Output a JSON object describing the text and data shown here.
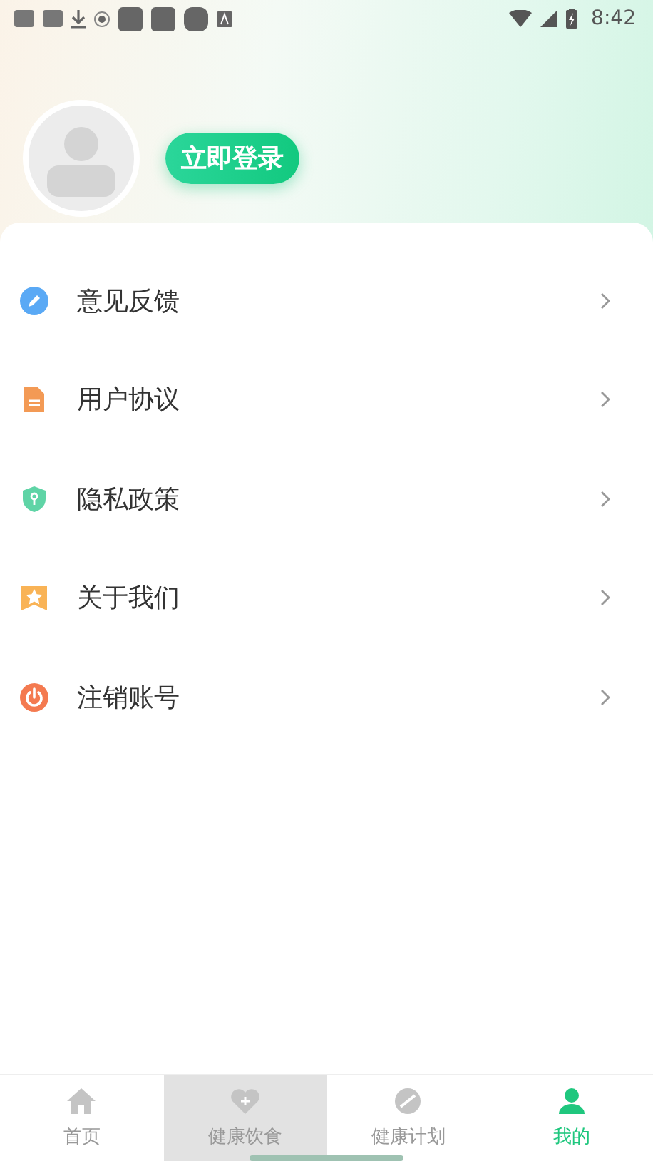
{
  "status_bar": {
    "time": "8:42"
  },
  "profile": {
    "login_button": "立即登录"
  },
  "menu": [
    {
      "label": "意见反馈",
      "kind": "feedback",
      "color": "#5aa9f5"
    },
    {
      "label": "用户协议",
      "kind": "agreement",
      "color": "#f39a55"
    },
    {
      "label": "隐私政策",
      "kind": "privacy",
      "color": "#5fd4a6"
    },
    {
      "label": "关于我们",
      "kind": "about",
      "color": "#f9b356"
    },
    {
      "label": "注销账号",
      "kind": "logout",
      "color": "#f47a50"
    }
  ],
  "tab_bar": [
    {
      "label": "首页",
      "kind": "home",
      "selected": false,
      "pressed": false
    },
    {
      "label": "健康饮食",
      "kind": "diet",
      "selected": false,
      "pressed": true
    },
    {
      "label": "健康计划",
      "kind": "plan",
      "selected": false,
      "pressed": false
    },
    {
      "label": "我的",
      "kind": "me",
      "selected": true,
      "pressed": false
    }
  ]
}
